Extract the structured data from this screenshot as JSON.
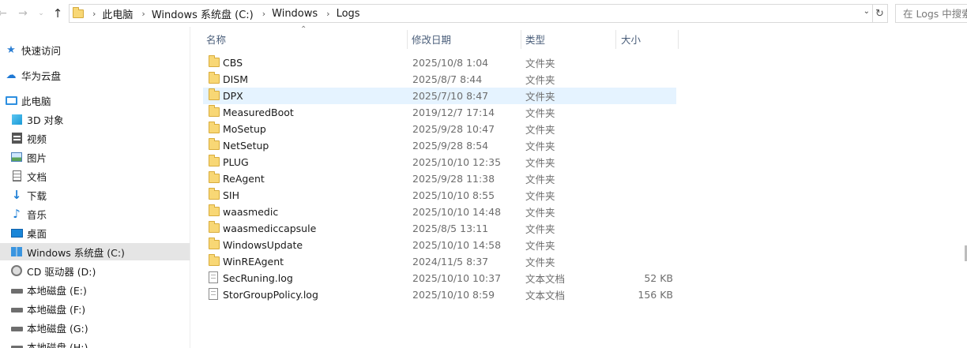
{
  "nav": {
    "back_icon": "arrow-left",
    "forward_icon": "arrow-right",
    "recent_icon": "chevron-down",
    "up_icon": "arrow-up"
  },
  "address": {
    "crumbs": [
      "此电脑",
      "Windows 系统盘 (C:)",
      "Windows",
      "Logs"
    ],
    "dropdown_icon": "chevron-down",
    "refresh_icon": "refresh"
  },
  "search": {
    "placeholder": "在 Logs 中搜索"
  },
  "sidebar": {
    "items": [
      {
        "label": "快速访问",
        "icon": "star-icon"
      },
      {
        "label": "华为云盘",
        "icon": "cloud-icon"
      },
      {
        "label": "此电脑",
        "icon": "computer-icon"
      },
      {
        "label": "3D 对象",
        "icon": "cube-icon"
      },
      {
        "label": "视频",
        "icon": "film-icon"
      },
      {
        "label": "图片",
        "icon": "picture-icon"
      },
      {
        "label": "文档",
        "icon": "document-icon"
      },
      {
        "label": "下载",
        "icon": "download-icon"
      },
      {
        "label": "音乐",
        "icon": "music-icon"
      },
      {
        "label": "桌面",
        "icon": "desktop-icon"
      },
      {
        "label": "Windows 系统盘 (C:)",
        "icon": "windows-drive-icon"
      },
      {
        "label": "CD 驱动器 (D:)",
        "icon": "cd-drive-icon"
      },
      {
        "label": "本地磁盘 (E:)",
        "icon": "hard-drive-icon"
      },
      {
        "label": "本地磁盘 (F:)",
        "icon": "hard-drive-icon"
      },
      {
        "label": "本地磁盘 (G:)",
        "icon": "hard-drive-icon"
      },
      {
        "label": "本地磁盘 (H:)",
        "icon": "hard-drive-icon"
      }
    ],
    "selected_index": 10
  },
  "columns": {
    "name": "名称",
    "date": "修改日期",
    "type": "类型",
    "size": "大小"
  },
  "files": [
    {
      "name": "CBS",
      "date": "2025/10/8 1:04",
      "type": "文件夹",
      "size": "",
      "icon": "folder-icon"
    },
    {
      "name": "DISM",
      "date": "2025/8/7 8:44",
      "type": "文件夹",
      "size": "",
      "icon": "folder-icon"
    },
    {
      "name": "DPX",
      "date": "2025/7/10 8:47",
      "type": "文件夹",
      "size": "",
      "icon": "folder-icon"
    },
    {
      "name": "MeasuredBoot",
      "date": "2019/12/7 17:14",
      "type": "文件夹",
      "size": "",
      "icon": "folder-icon"
    },
    {
      "name": "MoSetup",
      "date": "2025/9/28 10:47",
      "type": "文件夹",
      "size": "",
      "icon": "folder-icon"
    },
    {
      "name": "NetSetup",
      "date": "2025/9/28 8:54",
      "type": "文件夹",
      "size": "",
      "icon": "folder-icon"
    },
    {
      "name": "PLUG",
      "date": "2025/10/10 12:35",
      "type": "文件夹",
      "size": "",
      "icon": "folder-icon"
    },
    {
      "name": "ReAgent",
      "date": "2025/9/28 11:38",
      "type": "文件夹",
      "size": "",
      "icon": "folder-icon"
    },
    {
      "name": "SIH",
      "date": "2025/10/10 8:55",
      "type": "文件夹",
      "size": "",
      "icon": "folder-icon"
    },
    {
      "name": "waasmedic",
      "date": "2025/10/10 14:48",
      "type": "文件夹",
      "size": "",
      "icon": "folder-icon"
    },
    {
      "name": "waasmediccapsule",
      "date": "2025/8/5 13:11",
      "type": "文件夹",
      "size": "",
      "icon": "folder-icon"
    },
    {
      "name": "WindowsUpdate",
      "date": "2025/10/10 14:58",
      "type": "文件夹",
      "size": "",
      "icon": "folder-icon"
    },
    {
      "name": "WinREAgent",
      "date": "2024/11/5 8:37",
      "type": "文件夹",
      "size": "",
      "icon": "folder-icon"
    },
    {
      "name": "SecRuning.log",
      "date": "2025/10/10 10:37",
      "type": "文本文档",
      "size": "52 KB",
      "icon": "text-file-icon"
    },
    {
      "name": "StorGroupPolicy.log",
      "date": "2025/10/10 8:59",
      "type": "文本文档",
      "size": "156 KB",
      "icon": "text-file-icon"
    }
  ],
  "hovered_index": 2,
  "colors": {
    "hover_row": "#e5f3ff",
    "selected_nav": "#e5e5e5",
    "folder": "#f8d775",
    "header_text": "#4a5e7a"
  }
}
